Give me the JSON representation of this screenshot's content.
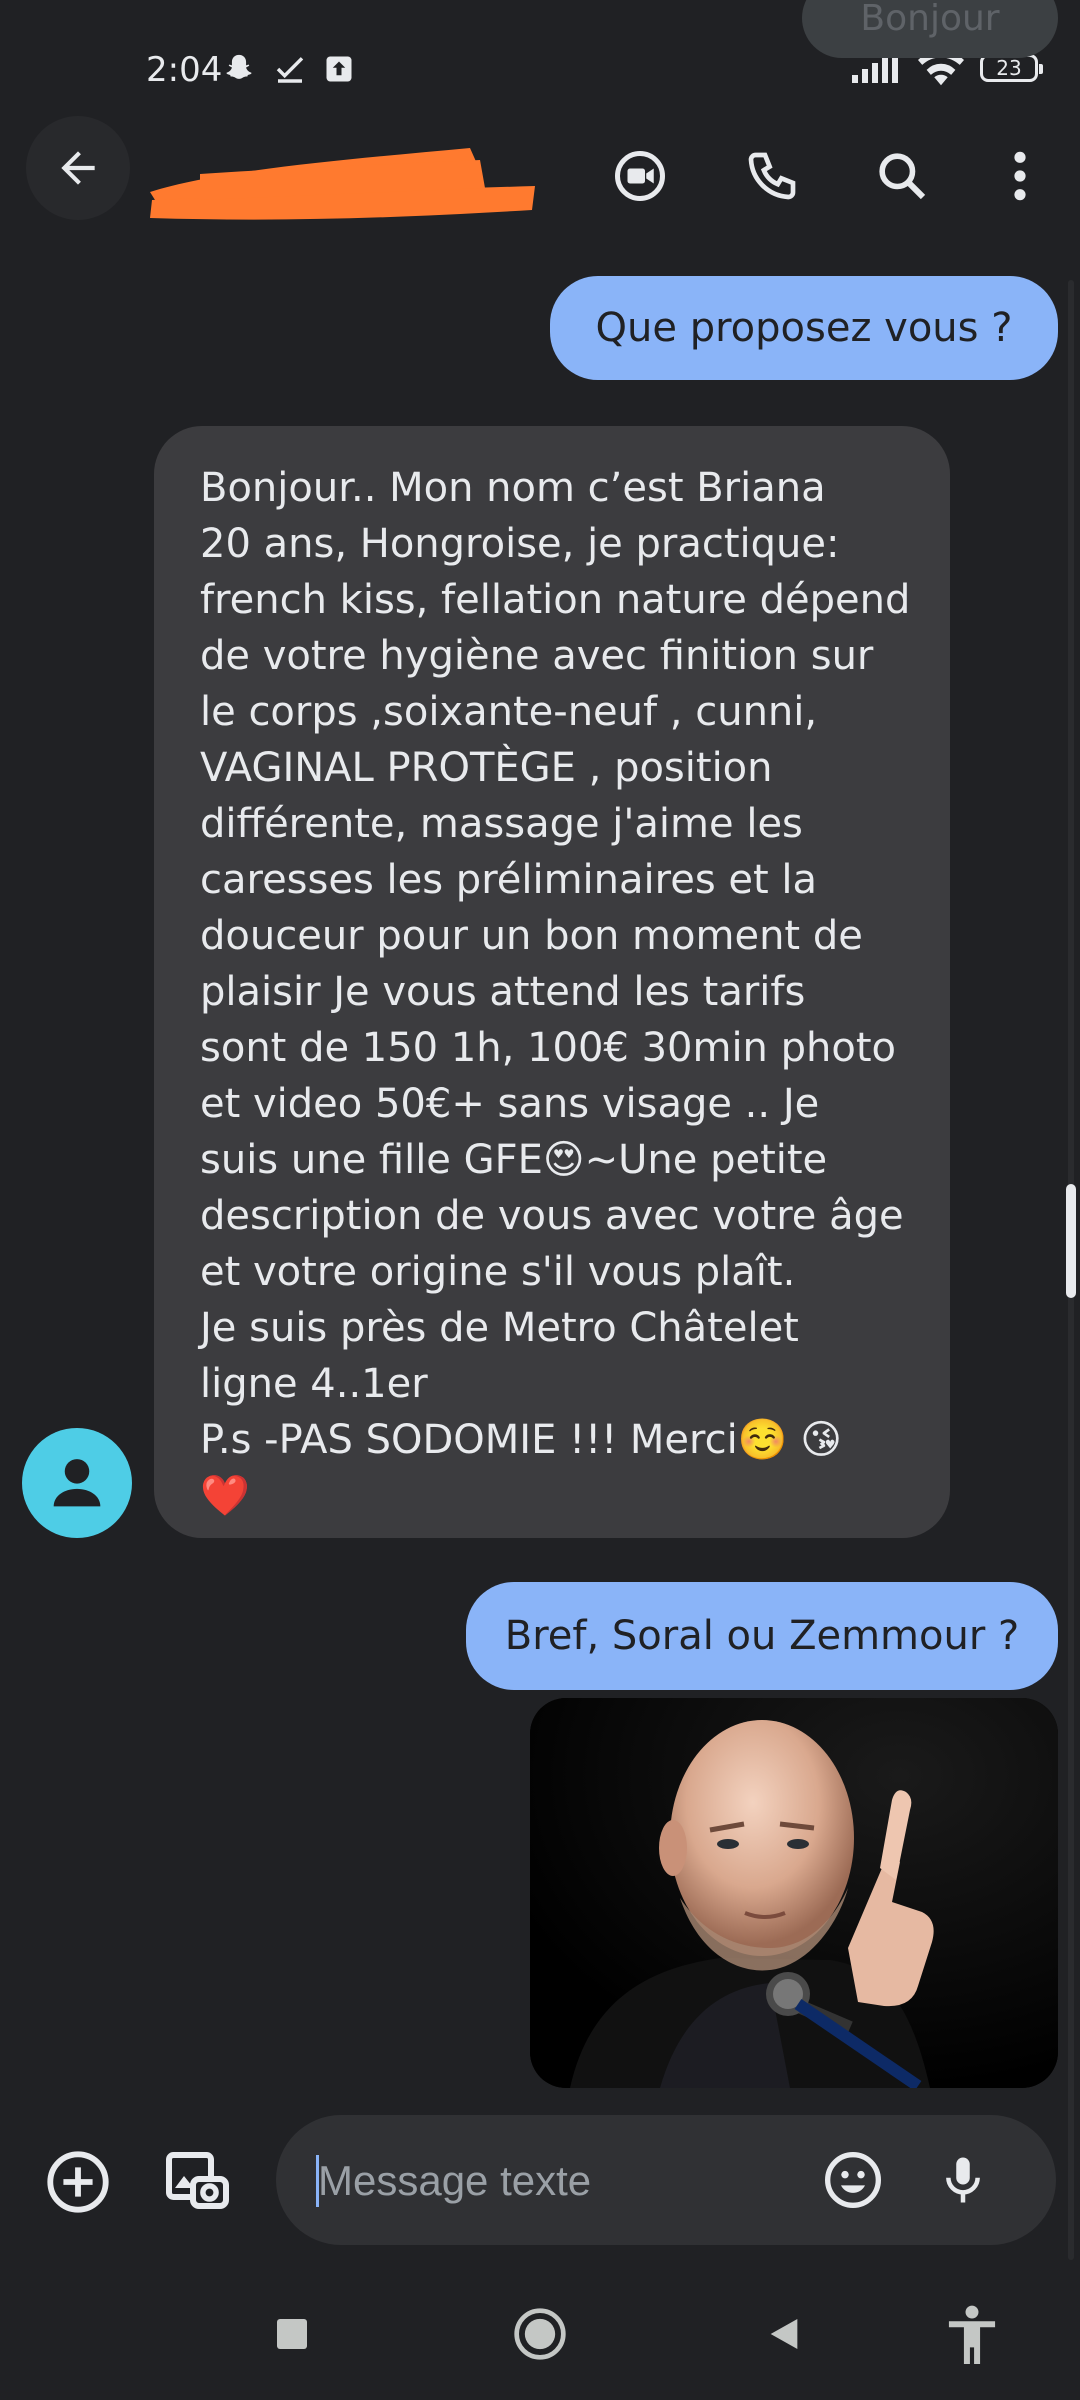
{
  "status_bar": {
    "time": "2:04",
    "battery_level": "23"
  },
  "top_chip": {
    "label": "Bonjour"
  },
  "app_bar": {
    "contact_name": ""
  },
  "messages": [
    {
      "direction": "outgoing",
      "text": "Que proposez vous ?"
    },
    {
      "direction": "incoming",
      "lines": [
        "Bonjour.. Mon nom c’est Briana",
        "20 ans, Hongroise, je practique:",
        "french kiss, fellation nature dépend",
        "de votre hygiène avec finition sur",
        "le corps ,soixante-neuf , cunni,",
        "VAGINAL PROTÈGE , position",
        "différente, massage j'aime les",
        "caresses les préliminaires et la",
        "douceur pour un bon moment de",
        "plaisir Je vous attend les tarifs",
        "sont de 150 1h, 100€ 30min photo",
        "et video 50€+ sans visage .. Je",
        "suis une fille GFE😍~Une petite",
        "description de vous avec votre âge",
        "et votre origine s'il vous plaît.",
        "Je suis près de Metro Châtelet",
        "ligne 4..1er",
        "P.s -PAS SODOMIE !!! Merci☺️ 😘",
        "❤️"
      ]
    },
    {
      "direction": "outgoing",
      "text": "Bref, Soral ou Zemmour ?"
    }
  ],
  "composer": {
    "placeholder": "Message texte"
  },
  "colors": {
    "background": "#202124",
    "outgoing_bubble": "#8ab4f8",
    "incoming_bubble": "#3c3c3f",
    "avatar": "#4ecde6"
  },
  "icons": {
    "app_bar": [
      "back-arrow-icon",
      "video-call-icon",
      "phone-icon",
      "search-icon",
      "more-vert-icon"
    ],
    "composer": [
      "add-circle-icon",
      "gallery-icon",
      "emoji-icon",
      "mic-icon"
    ],
    "nav_bar": [
      "recents-square-icon",
      "home-circle-icon",
      "back-triangle-icon",
      "accessibility-icon"
    ]
  }
}
